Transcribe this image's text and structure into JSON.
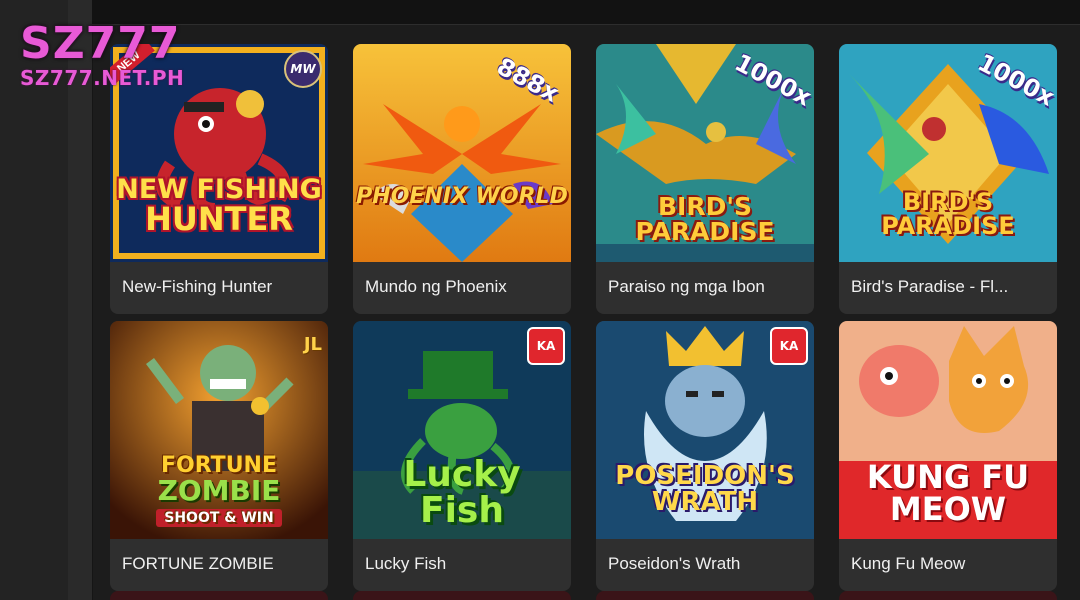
{
  "logo": {
    "main": "SZ777",
    "sub": "SZ777.NET.PH"
  },
  "games": [
    {
      "label": "New-Fishing Hunter",
      "art_text": [
        "NEW FISHING",
        "HUNTER"
      ],
      "badge": "",
      "provider": "MW",
      "tag": "NEW"
    },
    {
      "label": "Mundo ng Phoenix",
      "art_text": [
        "PHOENIX WORLD"
      ],
      "badge": "888x",
      "provider": "",
      "tag": ""
    },
    {
      "label": "Paraiso ng mga Ibon",
      "art_text": [
        "BIRD'S PARADISE"
      ],
      "badge": "1000x",
      "provider": "",
      "tag": ""
    },
    {
      "label": "Bird's Paradise - Fl...",
      "art_text": [
        "BIRD'S PARADISE"
      ],
      "badge": "1000x",
      "provider": "",
      "tag": ""
    },
    {
      "label": "FORTUNE ZOMBIE",
      "art_text": [
        "FORTUNE",
        "ZOMBIE",
        "SHOOT & WIN"
      ],
      "badge": "",
      "provider": "JL",
      "tag": ""
    },
    {
      "label": "Lucky Fish",
      "art_text": [
        "Lucky",
        "Fish"
      ],
      "badge": "",
      "provider": "KA",
      "tag": ""
    },
    {
      "label": "Poseidon's Wrath",
      "art_text": [
        "POSEIDON'S",
        "WRATH"
      ],
      "badge": "",
      "provider": "KA",
      "tag": ""
    },
    {
      "label": "Kung Fu Meow",
      "art_text": [
        "KUNG FU",
        "MEOW"
      ],
      "badge": "",
      "provider": "",
      "tag": ""
    }
  ],
  "colors": {
    "background": "#1c1c1c",
    "card": "#2f2f2f",
    "logo": "#e85ad6",
    "label_text": "#f0f0f0"
  }
}
